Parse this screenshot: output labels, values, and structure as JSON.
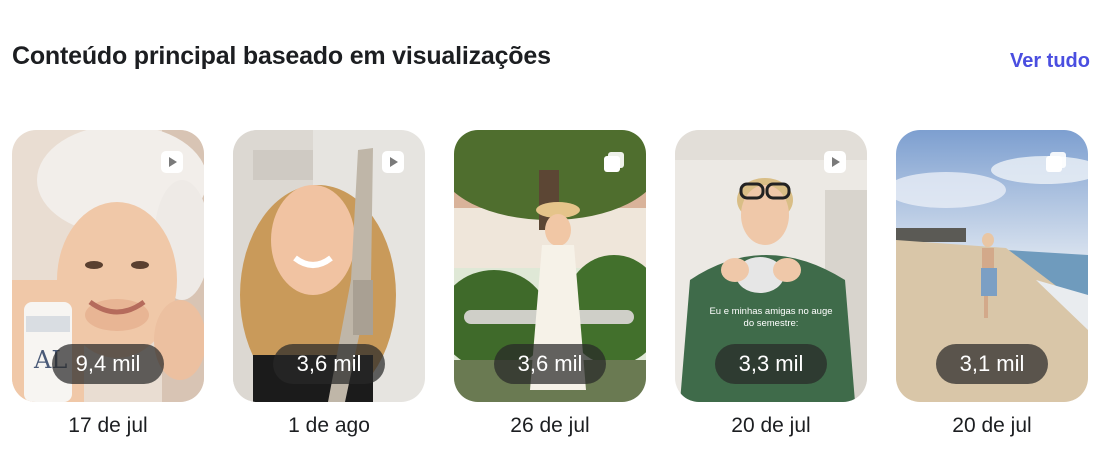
{
  "section": {
    "title": "Conteúdo principal baseado em visualizações",
    "see_all_label": "Ver tudo",
    "accent_color": "#4a4ee0"
  },
  "posts": [
    {
      "views": "9,4 mil",
      "date": "17 de jul",
      "type_icon": "reel-play-icon",
      "overlay_text": "",
      "label_text": "AL"
    },
    {
      "views": "3,6 mil",
      "date": "1 de ago",
      "type_icon": "reel-play-icon",
      "overlay_text": ""
    },
    {
      "views": "3,6 mil",
      "date": "26 de jul",
      "type_icon": "carousel-icon",
      "overlay_text": ""
    },
    {
      "views": "3,3 mil",
      "date": "20 de jul",
      "type_icon": "reel-play-icon",
      "overlay_text": "Eu e minhas amigas no auge do semestre:"
    },
    {
      "views": "3,1 mil",
      "date": "20 de jul",
      "type_icon": "carousel-icon",
      "overlay_text": ""
    }
  ]
}
